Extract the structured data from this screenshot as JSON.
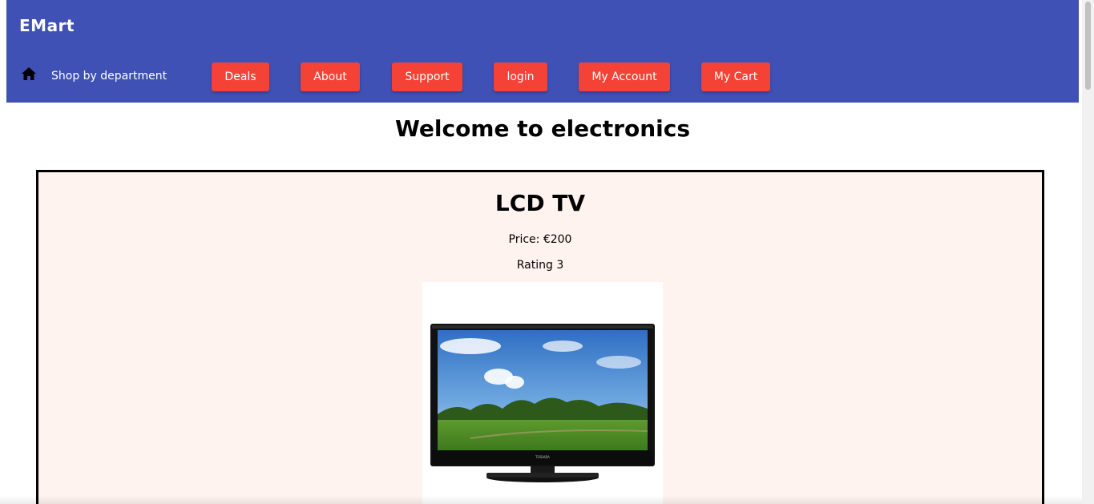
{
  "header": {
    "brand": "EMart",
    "home_icon": "home-icon",
    "shop_by_department": "Shop by department",
    "nav": [
      {
        "label": "Deals"
      },
      {
        "label": "About"
      },
      {
        "label": "Support"
      },
      {
        "label": "login"
      },
      {
        "label": "My Account"
      },
      {
        "label": "My Cart"
      }
    ]
  },
  "main": {
    "welcome": "Welcome to electronics",
    "product": {
      "name": "LCD TV",
      "price": "Price: €200",
      "rating": "Rating 3",
      "brand_on_tv": "TOSHIBA"
    }
  },
  "colors": {
    "header_bg": "#3f51b5",
    "button_bg": "#f44336",
    "card_bg": "#fff3ef"
  }
}
